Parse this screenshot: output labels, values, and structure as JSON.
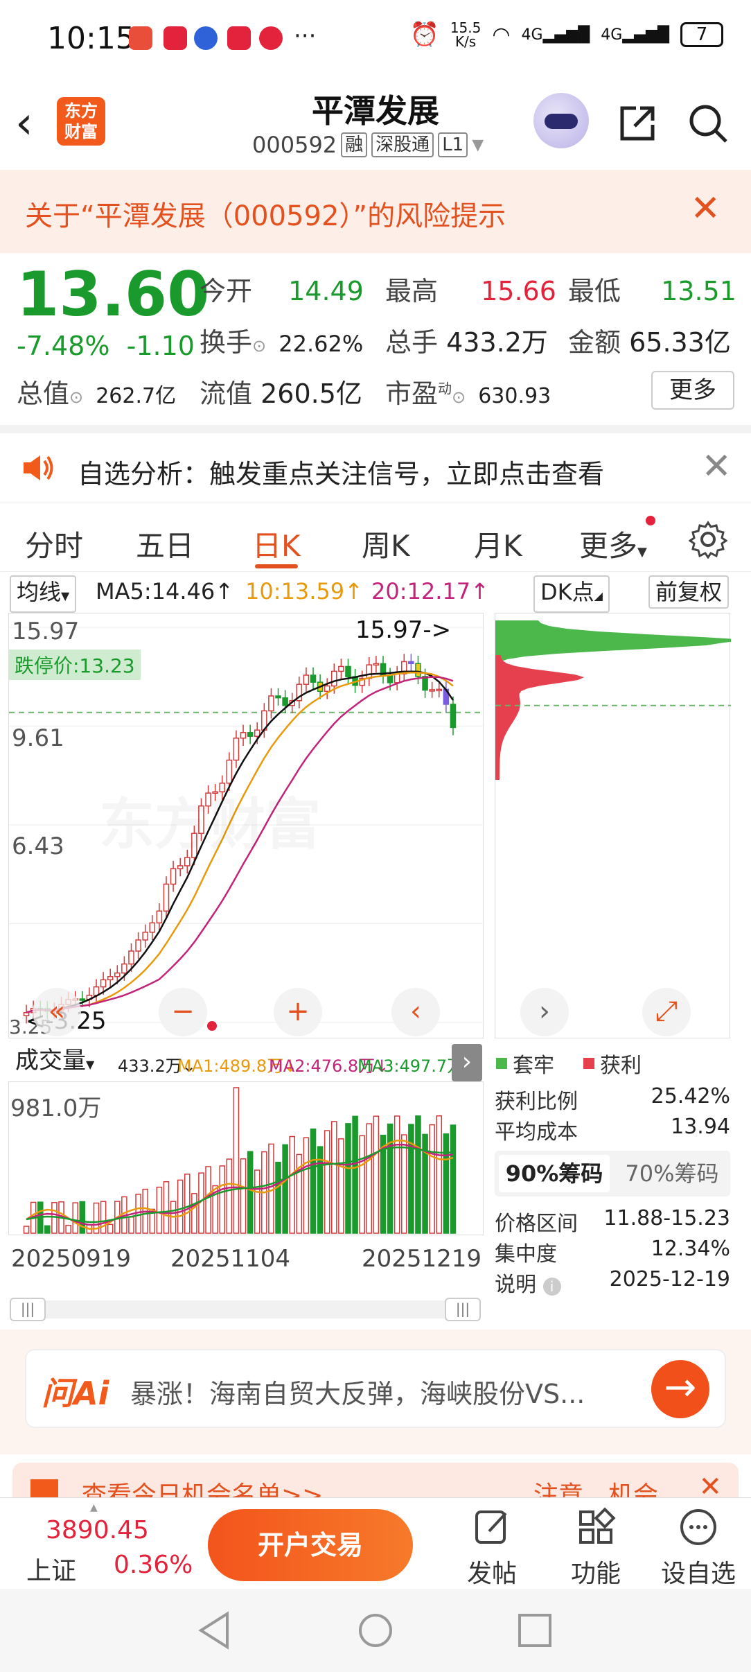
{
  "status": {
    "time": "10:15",
    "net_speed": "15.5\nK/s",
    "net_speed_line1": "15.5",
    "net_speed_line2": "K/s",
    "signal1": "4G",
    "signal2": "4G",
    "battery": "7",
    "more_dots": "···"
  },
  "header": {
    "back": "‹",
    "logo_line1": "东方",
    "logo_line2": "财富",
    "stock_name": "平潭发展",
    "stock_code": "000592",
    "tag1": "融",
    "tag2": "深股通",
    "tag3": "L1"
  },
  "risk": {
    "text": "关于“平潭发展（000592）”的风险提示",
    "close": "✕"
  },
  "quote": {
    "price": "13.60",
    "change_pct": "-7.48%",
    "change_abs": "-1.10",
    "open_label": "今开",
    "open": "14.49",
    "high_label": "最高",
    "high": "15.66",
    "low_label": "最低",
    "low": "13.51",
    "turnover_label": "换手",
    "turnover": "22.62%",
    "volume_label": "总手",
    "volume": "433.2万",
    "amount_label": "金额",
    "amount": "65.33亿",
    "mktcap_label": "总值",
    "mktcap": "262.7亿",
    "float_label": "流值",
    "float": "260.5亿",
    "pe_label": "市盈",
    "pe_sup": "动",
    "pe": "630.93",
    "more": "更多"
  },
  "analysis": {
    "text": "自选分析：触发重点关注信号，立即点击查看",
    "close": "✕"
  },
  "tabs": [
    "分时",
    "五日",
    "日K",
    "周K",
    "月K",
    "更多"
  ],
  "active_tab": "日K",
  "controls": {
    "ma_btn": "均线",
    "ma5": "MA5:14.46↑",
    "ma10": "10:13.59↑",
    "ma20": "20:12.17↑",
    "dk_btn": "DK点",
    "adj_btn": "前复权"
  },
  "kchart": {
    "y_top": "15.97",
    "y_mid1": "9.61",
    "y_mid2": "6.43",
    "y_bottom": "3.25",
    "max_label": "15.97->",
    "min_label": "<-3.25",
    "limit_label": "跌停价:13.23",
    "watermark": "东方财富"
  },
  "chart_data": {
    "type": "bar",
    "title": "",
    "ylim": [
      3.25,
      15.97
    ],
    "x_ticks": [
      "20250919",
      "20251104",
      "20251219"
    ],
    "reference": {
      "label": "跌停价",
      "value": 13.23
    },
    "max_price": 15.97,
    "min_price": 3.25,
    "ma": {
      "MA5": 14.46,
      "MA10": 13.59,
      "MA20": 12.17
    },
    "volume": {
      "current": "433.2万",
      "MA1": "489.8万",
      "MA2": "476.8万",
      "MA3": "497.7万",
      "ymax": "981.0万"
    }
  },
  "volume_hdr": {
    "selector": "成交量",
    "cur": "433.2万↓",
    "ma1": "MA1:489.8万↓",
    "ma2": "MA2:476.8万↓",
    "ma3": "MA3:497.7万↓",
    "ymax": "981.0万"
  },
  "dates": [
    "20250919",
    "20251104",
    "20251219"
  ],
  "chip": {
    "legend_trap": "套牢",
    "legend_profit": "获利",
    "profit_ratio_label": "获利比例",
    "profit_ratio": "25.42%",
    "avg_cost_label": "平均成本",
    "avg_cost": "13.94",
    "seg_90": "90%筹码",
    "seg_70": "70%筹码",
    "range_label": "价格区间",
    "range": "11.88-15.23",
    "concentration_label": "集中度",
    "concentration": "12.34%",
    "note_label": "说明",
    "note": "2025-12-19"
  },
  "ai": {
    "logo": "问Ai",
    "text": "暴涨！海南自贸大反弹，海峡股份VS..."
  },
  "opp": {
    "left": "查看今日机会名单>>",
    "right": "注意，机会"
  },
  "bottom": {
    "index_value": "3890.45",
    "index_name": "上证",
    "index_pct": "0.36%",
    "trade_btn": "开户交易",
    "post": "发帖",
    "func": "功能",
    "watch": "设自选"
  },
  "colors": {
    "accent": "#e3511f",
    "up": "#e2233b",
    "down": "#1a9a2c",
    "trap": "#4cb84c",
    "profit": "#e6404e"
  }
}
